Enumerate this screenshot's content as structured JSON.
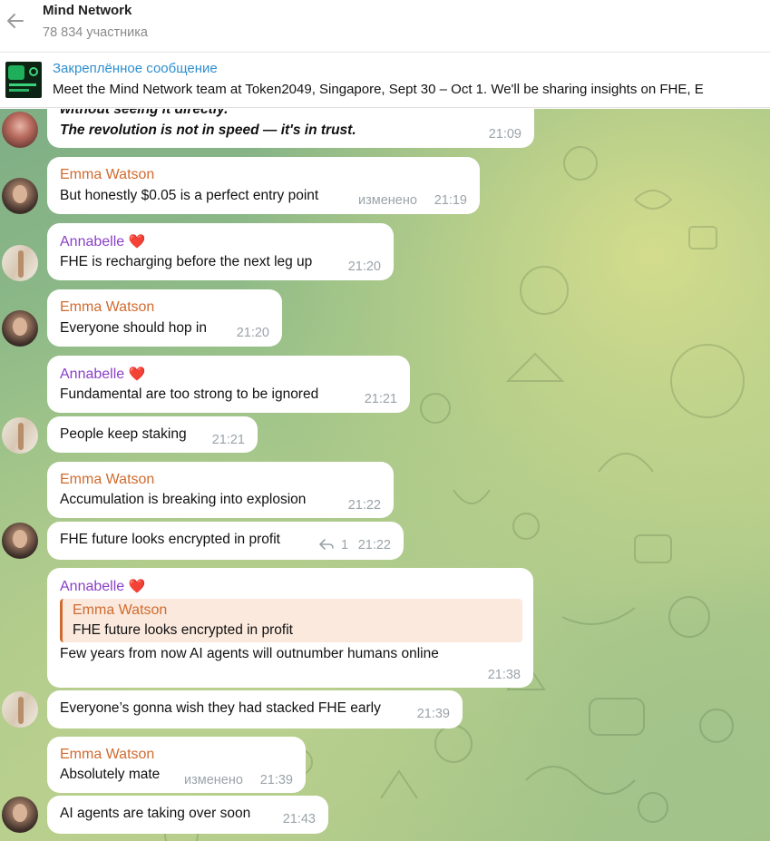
{
  "header": {
    "title": "Mind Network",
    "subtitle": "78 834 участника",
    "back_icon": "arrow-left-icon"
  },
  "pinned": {
    "title": "Закреплённое сообщение",
    "text": "Meet the Mind Network team at Token2049, Singapore, Sept 30 – Oct 1.  We'll be sharing insights on FHE, E"
  },
  "messages": {
    "top": {
      "line1": "without seeing it directly.",
      "line2": "The revolution is not in speed — it's in trust.",
      "time": "21:09"
    },
    "m1": {
      "sender": "Emma Watson",
      "text": "But honestly $0.05 is a perfect entry point",
      "edited": "изменено",
      "time": "21:19"
    },
    "m2": {
      "sender": "Annabelle",
      "heart": "❤️",
      "text": "FHE is recharging before the next leg up",
      "time": "21:20"
    },
    "m3": {
      "sender": "Emma Watson",
      "text": "Everyone should hop in",
      "time": "21:20"
    },
    "m4": {
      "sender": "Annabelle",
      "heart": "❤️",
      "text": "Fundamental are too strong to be ignored",
      "time": "21:21"
    },
    "m5": {
      "text": "People keep staking",
      "time": "21:21"
    },
    "m6": {
      "sender": "Emma Watson",
      "text": "Accumulation is breaking into explosion",
      "time": "21:22"
    },
    "m7": {
      "text": "FHE future looks encrypted in profit",
      "replies": "1",
      "time": "21:22"
    },
    "m8": {
      "sender": "Annabelle",
      "heart": "❤️",
      "quote_name": "Emma Watson",
      "quote_text": "FHE future looks encrypted in profit",
      "text": "Few years from now AI agents will outnumber humans online",
      "time": "21:38"
    },
    "m9": {
      "text": "Everyone’s gonna wish they had stacked FHE early",
      "time": "21:39"
    },
    "m10": {
      "sender": "Emma Watson",
      "text": "Absolutely mate",
      "edited": "изменено",
      "time": "21:39"
    },
    "m11": {
      "text": "AI agents are taking over soon",
      "time": "21:43"
    }
  }
}
